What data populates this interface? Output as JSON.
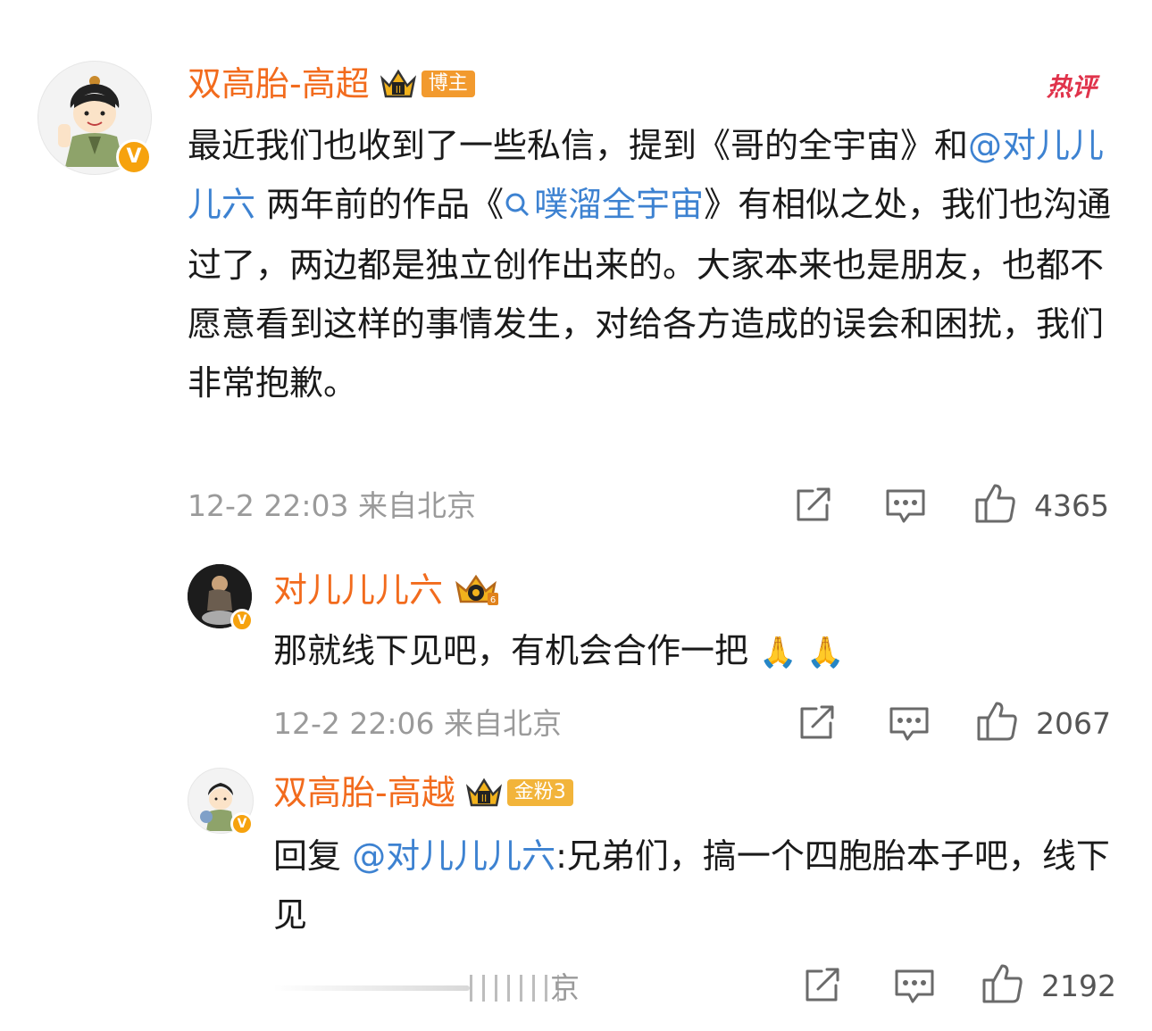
{
  "comments": [
    {
      "username": "双高胎-高超",
      "badge_label": "博主",
      "hot_label": "热评",
      "text_parts": {
        "p1": "最近我们也收到了一些私信，提到《哥的全宇宙》和",
        "mention": "@对儿儿儿六",
        "p2": " 两年前的作品《",
        "link": "噗溜全宇宙",
        "p3": "》有相似之处，我们也沟通过了，两边都是独立创作出来的。大家本来也是朋友，也都不愿意看到这样的事情发生，对给各方造成的误会和困扰，我们非常抱歉。"
      },
      "time": "12-2 22:03 来自北京",
      "likes": "4365"
    },
    {
      "username": "对儿儿儿六",
      "text": "那就线下见吧，有机会合作一把",
      "emoji": "🙏 🙏",
      "time": "12-2 22:06 来自北京",
      "likes": "2067"
    },
    {
      "username": "双高胎-高越",
      "badge_label": "金粉3",
      "text_parts": {
        "prefix": "回复 ",
        "mention": "@对儿儿儿六",
        "rest": ":兄弟们，搞一个四胞胎本子吧，线下见"
      },
      "time_partial": "京",
      "likes": "2192"
    }
  ],
  "icons": {
    "share": "share-icon",
    "comment": "comment-icon",
    "like": "thumbs-up-icon",
    "crown": "crown-icon",
    "verified": "verified-v-icon"
  },
  "colors": {
    "username": "#f26b1d",
    "mention": "#3d82d1",
    "meta": "#9a9a9a",
    "badge_orange": "#f6a20e",
    "hot": "#e0334b"
  }
}
